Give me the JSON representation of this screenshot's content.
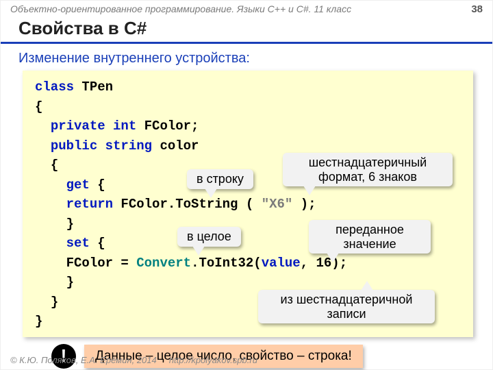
{
  "header": {
    "course": "Объектно-ориентированное программирование. Языки C++ и C#. 11 класс",
    "page": "38"
  },
  "title": "Свойства в C#",
  "subtitle": "Изменение внутреннего устройства:",
  "code": {
    "line1_kw1": "class",
    "line1_id": " TPen",
    "l2": "{",
    "l3_kw": "private int",
    "l3_rest": " FColor;",
    "l4_kw": "public string",
    "l4_rest": " color",
    "l5": "{",
    "l6_kw": "get",
    "l6_rest": " {",
    "l7_kw": "return",
    "l7_mid": " FColor.ToString",
    "l7_paren": " ( ",
    "l7_str": "\"X6\"",
    "l7_end": " );",
    "l8": "}",
    "l9_kw": "set",
    "l9_rest": " {",
    "l10_a": "FColor = ",
    "l10_conv": "Convert",
    "l10_b": ".ToInt32(",
    "l10_val": "value",
    "l10_c": ", 16);",
    "l11": "}",
    "l12": "}",
    "l13": "}"
  },
  "callouts": {
    "to_string": "в строку",
    "hex_format": "шестнадцатеричный формат, 6 знаков",
    "to_int": "в целое",
    "passed_value": "переданное значение",
    "from_hex": "из шестнадцатеричной записи"
  },
  "note": {
    "bang": "!",
    "text": "Данные – целое число, свойство – строка!"
  },
  "footer": {
    "copyright": "© К.Ю. Поляков, Е.А. Ерёмин, 2014",
    "url": "http://kpolyakov.spb.ru"
  }
}
